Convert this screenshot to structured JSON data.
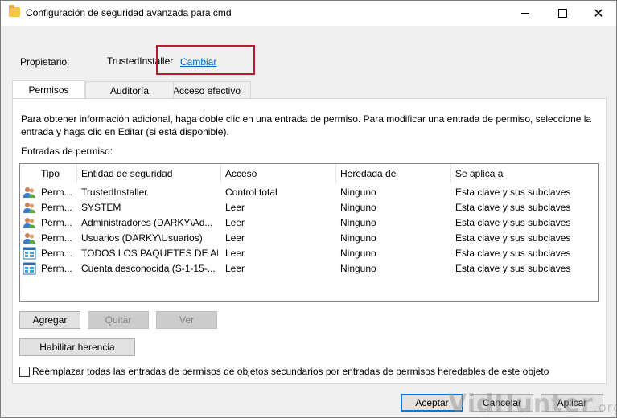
{
  "window": {
    "title": "Configuración de seguridad avanzada para cmd",
    "controls": {
      "minimize": "—",
      "maximize": "□",
      "close": "✕"
    }
  },
  "owner": {
    "label": "Propietario:",
    "value": "TrustedInstaller",
    "change_link": "Cambiar",
    "highlight_color": "#b41c2b"
  },
  "tabs": [
    {
      "label": "Permisos",
      "active": true
    },
    {
      "label": "Auditoría",
      "active": false
    },
    {
      "label": "Acceso efectivo",
      "active": false
    }
  ],
  "info_text": "Para obtener información adicional, haga doble clic en una entrada de permiso. Para modificar una entrada de permiso, seleccione la entrada y haga clic en Editar (si está disponible).",
  "entries_label": "Entradas de permiso:",
  "table": {
    "columns": [
      "Tipo",
      "Entidad de seguridad",
      "Acceso",
      "Heredada de",
      "Se aplica a"
    ],
    "rows": [
      {
        "icon": "users-icon",
        "tipo": "Perm...",
        "entidad": "TrustedInstaller",
        "acceso": "Control total",
        "heredada": "Ninguno",
        "aplica": "Esta clave y sus subclaves"
      },
      {
        "icon": "users-icon",
        "tipo": "Perm...",
        "entidad": "SYSTEM",
        "acceso": "Leer",
        "heredada": "Ninguno",
        "aplica": "Esta clave y sus subclaves"
      },
      {
        "icon": "users-icon",
        "tipo": "Perm...",
        "entidad": "Administradores (DARKY\\Ad...",
        "acceso": "Leer",
        "heredada": "Ninguno",
        "aplica": "Esta clave y sus subclaves"
      },
      {
        "icon": "users-icon",
        "tipo": "Perm...",
        "entidad": "Usuarios (DARKY\\Usuarios)",
        "acceso": "Leer",
        "heredada": "Ninguno",
        "aplica": "Esta clave y sus subclaves"
      },
      {
        "icon": "app-package-icon",
        "tipo": "Perm...",
        "entidad": "TODOS LOS PAQUETES DE AP...",
        "acceso": "Leer",
        "heredada": "Ninguno",
        "aplica": "Esta clave y sus subclaves"
      },
      {
        "icon": "app-package-icon",
        "tipo": "Perm...",
        "entidad": "Cuenta desconocida (S-1-15-...",
        "acceso": "Leer",
        "heredada": "Ninguno",
        "aplica": "Esta clave y sus subclaves"
      }
    ]
  },
  "buttons": {
    "agregar": "Agregar",
    "quitar": "Quitar",
    "ver": "Ver",
    "herencia": "Habilitar herencia",
    "aceptar": "Aceptar",
    "cancelar": "Cancelar",
    "aplicar": "Aplicar"
  },
  "checkbox": {
    "label": "Reemplazar todas las entradas de permisos de objetos secundarios por entradas de permisos heredables de este objeto",
    "checked": false
  },
  "watermark": {
    "main": "VidHunter",
    "suffix": ".org"
  },
  "colors": {
    "accent": "#0078d7",
    "link": "#0066cc"
  }
}
